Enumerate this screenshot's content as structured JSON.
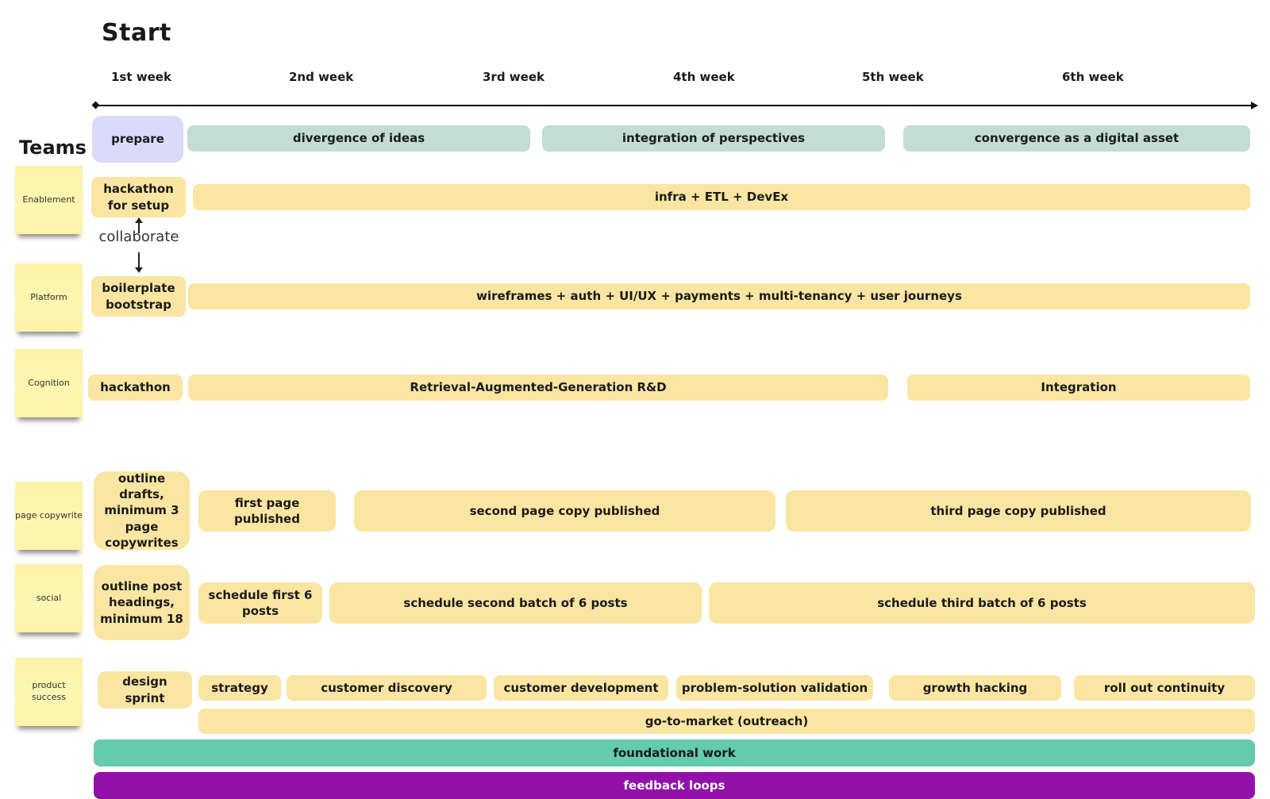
{
  "title": "Start",
  "teams_heading": "Teams",
  "weeks": [
    "1st week",
    "2nd week",
    "3rd week",
    "4th week",
    "5th week",
    "6th week"
  ],
  "phases": {
    "prepare": "prepare",
    "divergence": "divergence of ideas",
    "integration": "integration of perspectives",
    "convergence": "convergence as a digital asset"
  },
  "collaborate_label": "collaborate",
  "teams": [
    {
      "name": "Enablement",
      "tasks": [
        "hackathon for setup",
        "infra + ETL + DevEx"
      ]
    },
    {
      "name": "Platform",
      "tasks": [
        "boilerplate bootstrap",
        "wireframes + auth + UI/UX + payments + multi-tenancy + user journeys"
      ]
    },
    {
      "name": "Cognition",
      "tasks": [
        "hackathon",
        "Retrieval-Augmented-Generation R&D",
        "Integration"
      ]
    },
    {
      "name": "page copywrite",
      "tasks": [
        "outline drafts, minimum 3 page copywrites",
        "first page published",
        "second page copy published",
        "third page copy published"
      ]
    },
    {
      "name": "social",
      "tasks": [
        "outline post headings, minimum 18",
        "schedule first 6 posts",
        "schedule second batch of 6 posts",
        "schedule third batch of 6 posts"
      ]
    },
    {
      "name": "product success",
      "tasks": [
        "design sprint",
        "strategy",
        "customer discovery",
        "customer development",
        "problem-solution validation",
        "growth hacking",
        "roll out continuity",
        "go-to-market (outreach)"
      ]
    }
  ],
  "bottom_bars": {
    "foundational": "foundational work",
    "feedback": "feedback loops"
  },
  "colors": {
    "task": "#fae6a2",
    "phase": "#c3ddd5",
    "prepare": "#d8dcfa",
    "foundational": "#64cbad",
    "feedback": "#9211ab",
    "sticky": "#fdf5a8"
  }
}
